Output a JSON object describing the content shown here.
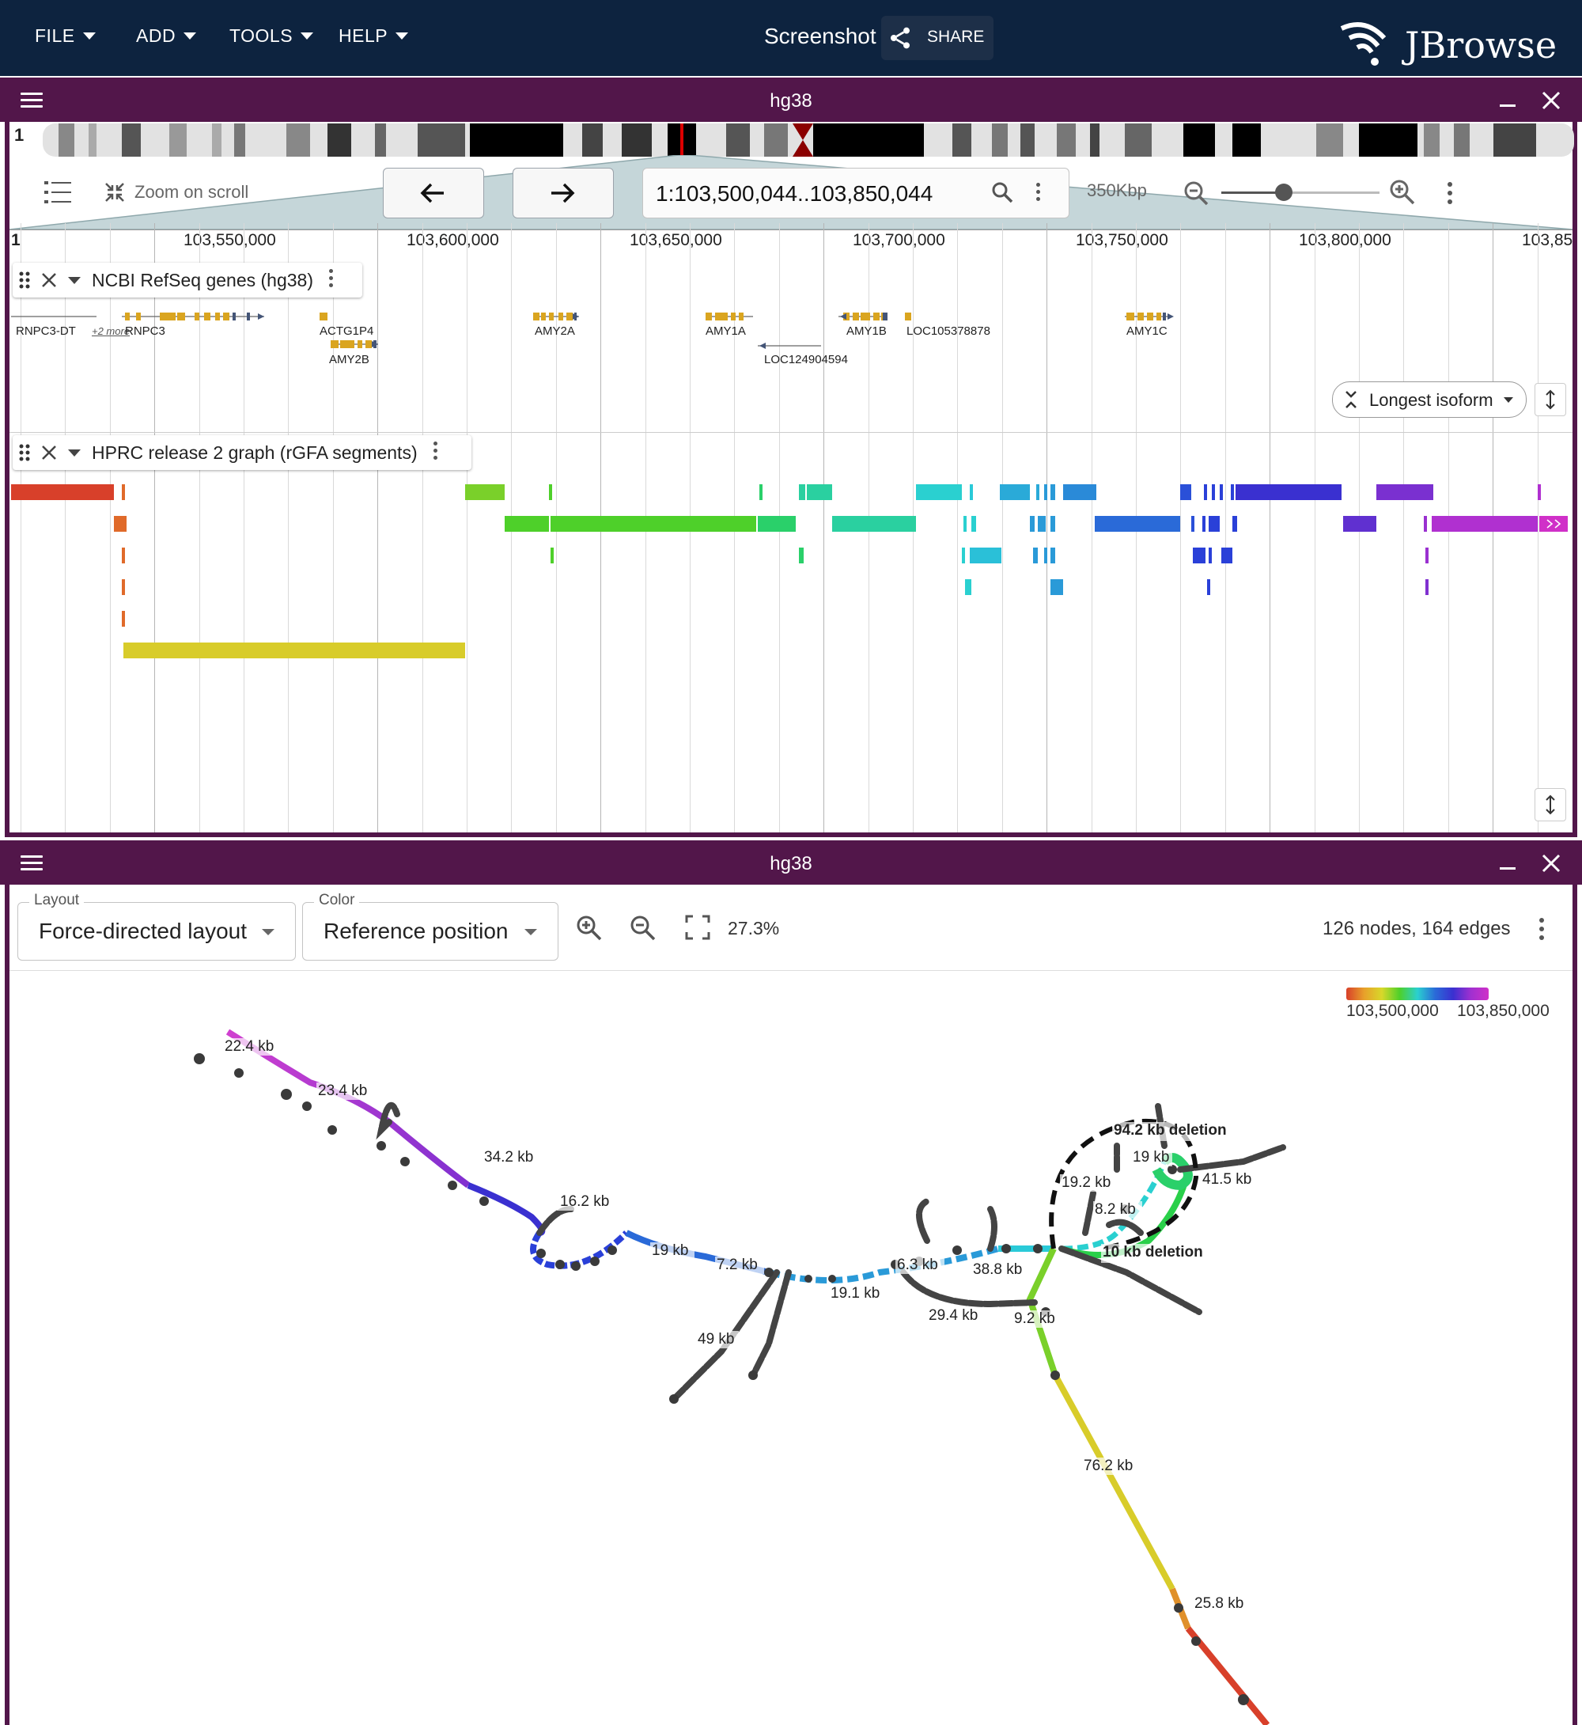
{
  "appbar": {
    "menus": [
      "FILE",
      "ADD",
      "TOOLS",
      "HELP"
    ],
    "screenshot_label": "Screenshot",
    "share_label": "SHARE",
    "logo_text": "JBrowse"
  },
  "linear_view": {
    "title": "hg38",
    "chromosome": "1",
    "zoom_on_scroll_label": "Zoom on scroll",
    "location": "1:103,500,044..103,850,044",
    "span_label": "350Kbp",
    "ruler_ref": "1",
    "ruler_ticks": [
      "103,550,000",
      "103,600,000",
      "103,650,000",
      "103,700,000",
      "103,750,000",
      "103,800,000",
      "103,85"
    ],
    "tracks": {
      "genes": {
        "title": "NCBI RefSeq genes (hg38)",
        "labels": [
          "RNPC3-DT",
          "+2 more",
          "RNPC3",
          "ACTG1P4",
          "AMY2B",
          "AMY2A",
          "AMY1A",
          "LOC124904594",
          "AMY1B",
          "LOC105378878",
          "AMY1C"
        ],
        "isoform_button": "Longest isoform"
      },
      "graph": {
        "title": "HPRC release 2 graph (rGFA segments)"
      }
    }
  },
  "graph_view": {
    "title": "hg38",
    "layout_label": "Layout",
    "layout_value": "Force-directed layout",
    "color_label": "Color",
    "color_value": "Reference position",
    "zoom_percent": "27.3%",
    "stats": "126 nodes, 164 edges",
    "legend": {
      "min": "103,500,000",
      "max": "103,850,000"
    },
    "edge_labels": [
      "22.4 kb",
      "23.4 kb",
      "34.2 kb",
      "16.2 kb",
      "19 kb",
      "7.2 kb",
      "49 kb",
      "19.1 kb",
      "6.3 kb",
      "29.4 kb",
      "38.8 kb",
      "9.2 kb",
      "76.2 kb",
      "25.8 kb",
      "19.2 kb",
      "8.2 kb",
      "19 kb",
      "41.5 kb",
      "94.2 kb deletion",
      "10 kb deletion"
    ]
  },
  "colors": {
    "appbar_bg": "#0d233f",
    "view_header": "#52164a",
    "gene_feature": "#daa520",
    "ruler_overview": "#c5d6d9"
  },
  "icons": [
    "chevron-down-icon",
    "share-icon",
    "menu-icon",
    "minimize-icon",
    "close-icon",
    "arrow-left-icon",
    "arrow-right-icon",
    "search-icon",
    "zoom-in-icon",
    "zoom-out-icon",
    "more-vert-icon",
    "drag-handle-icon",
    "fit-screen-icon",
    "track-list-icon",
    "collapse-icon",
    "resize-vertical-icon"
  ]
}
